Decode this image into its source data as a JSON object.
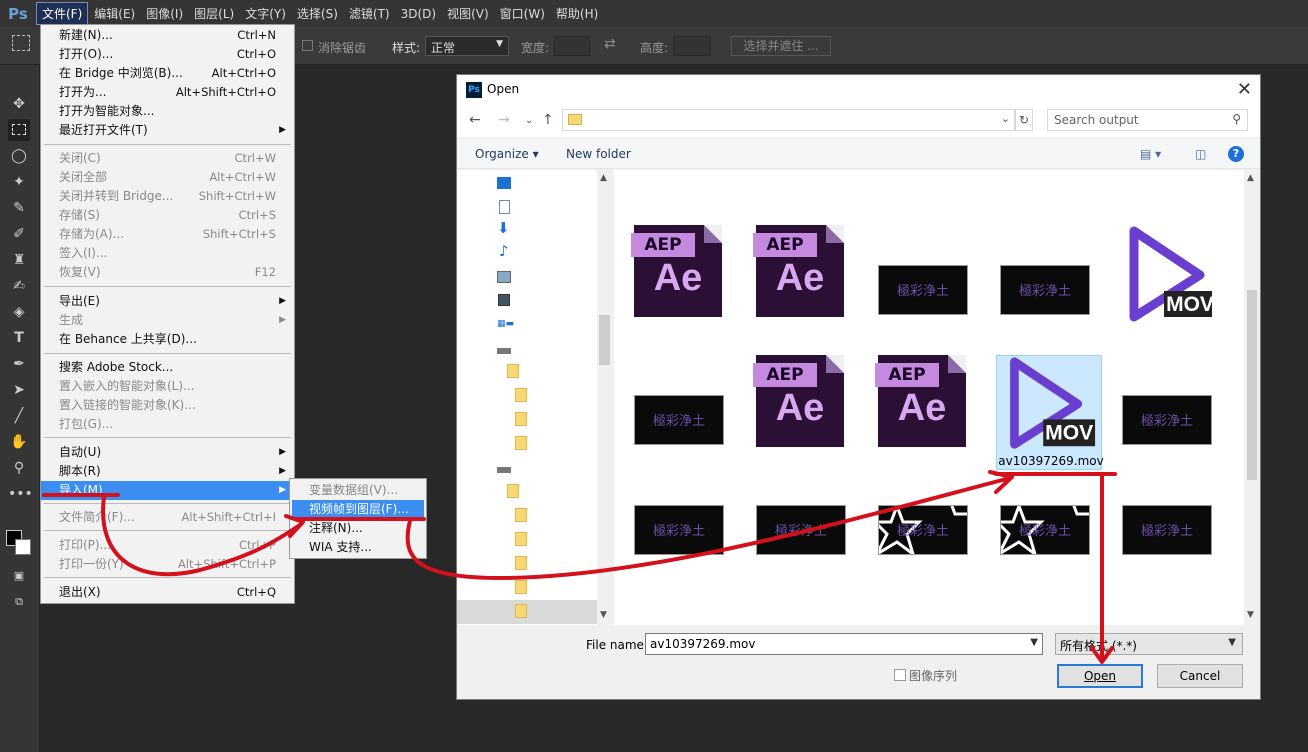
{
  "menubar": {
    "logo": "Ps",
    "items": [
      "文件(F)",
      "编辑(E)",
      "图像(I)",
      "图层(L)",
      "文字(Y)",
      "选择(S)",
      "滤镜(T)",
      "3D(D)",
      "视图(V)",
      "窗口(W)",
      "帮助(H)"
    ]
  },
  "options": {
    "antialias": "消除锯齿",
    "style_label": "样式:",
    "style_value": "正常",
    "width_label": "宽度:",
    "height_label": "高度:",
    "refine_button": "选择并遮住 ..."
  },
  "file_menu": {
    "items": [
      {
        "label": "新建(N)...",
        "shortcut": "Ctrl+N"
      },
      {
        "label": "打开(O)...",
        "shortcut": "Ctrl+O"
      },
      {
        "label": "在 Bridge 中浏览(B)...",
        "shortcut": "Alt+Ctrl+O"
      },
      {
        "label": "打开为...",
        "shortcut": "Alt+Shift+Ctrl+O"
      },
      {
        "label": "打开为智能对象..."
      },
      {
        "label": "最近打开文件(T)",
        "submenu": true
      },
      {
        "label": "关闭(C)",
        "shortcut": "Ctrl+W",
        "disabled": true
      },
      {
        "label": "关闭全部",
        "shortcut": "Alt+Ctrl+W",
        "disabled": true
      },
      {
        "label": "关闭并转到 Bridge...",
        "shortcut": "Shift+Ctrl+W",
        "disabled": true
      },
      {
        "label": "存储(S)",
        "shortcut": "Ctrl+S",
        "disabled": true
      },
      {
        "label": "存储为(A)...",
        "shortcut": "Shift+Ctrl+S",
        "disabled": true
      },
      {
        "label": "签入(I)...",
        "disabled": true
      },
      {
        "label": "恢复(V)",
        "shortcut": "F12",
        "disabled": true
      },
      {
        "label": "导出(E)",
        "submenu": true
      },
      {
        "label": "生成",
        "submenu": true,
        "disabled": true
      },
      {
        "label": "在 Behance 上共享(D)..."
      },
      {
        "label": "搜索 Adobe Stock..."
      },
      {
        "label": "置入嵌入的智能对象(L)...",
        "disabled": true
      },
      {
        "label": "置入链接的智能对象(K)...",
        "disabled": true
      },
      {
        "label": "打包(G)...",
        "disabled": true
      },
      {
        "label": "自动(U)",
        "submenu": true
      },
      {
        "label": "脚本(R)",
        "submenu": true
      },
      {
        "label": "导入(M)",
        "submenu": true,
        "highlighted": true
      },
      {
        "label": "文件简介(F)...",
        "shortcut": "Alt+Shift+Ctrl+I",
        "disabled": true
      },
      {
        "label": "打印(P)...",
        "shortcut": "Ctrl+P",
        "disabled": true
      },
      {
        "label": "打印一份(Y)",
        "shortcut": "Alt+Shift+Ctrl+P",
        "disabled": true
      },
      {
        "label": "退出(X)",
        "shortcut": "Ctrl+Q"
      }
    ]
  },
  "import_submenu": {
    "items": [
      {
        "label": "变量数据组(V)...",
        "disabled": true
      },
      {
        "label": "视频帧到图层(F)...",
        "highlighted": true
      },
      {
        "label": "注释(N)..."
      },
      {
        "label": "WIA 支持..."
      }
    ]
  },
  "dialog": {
    "title": "Open",
    "search_placeholder": "Search output",
    "organize": "Organize ▾",
    "new_folder": "New folder",
    "files": [
      {
        "type": "ae",
        "tag": "AEP",
        "letters": "Ae"
      },
      {
        "type": "ae",
        "tag": "AEP",
        "letters": "Ae"
      },
      {
        "type": "thumb",
        "title": "極彩浄土"
      },
      {
        "type": "thumb",
        "title": "極彩浄土"
      },
      {
        "type": "mov",
        "badge": "MOV"
      },
      {
        "type": "thumb",
        "title": "極彩浄土"
      },
      {
        "type": "ae",
        "tag": "AEP",
        "letters": "Ae"
      },
      {
        "type": "ae",
        "tag": "AEP",
        "letters": "Ae"
      },
      {
        "type": "mov",
        "badge": "MOV",
        "name": "av10397269.mov",
        "selected": true
      },
      {
        "type": "thumb",
        "title": "極彩浄土"
      },
      {
        "type": "thumb",
        "title": "極彩浄土"
      },
      {
        "type": "thumb",
        "title": "極彩浄土"
      },
      {
        "type": "thumb-star",
        "title": "極彩浄土"
      },
      {
        "type": "thumb-star",
        "title": "極彩浄土"
      },
      {
        "type": "thumb",
        "title": "極彩浄土"
      }
    ],
    "filename_label": "File name:",
    "filename_value": "av10397269.mov",
    "filetype_value": "所有格式 (*.*)",
    "image_sequence_label": "图像序列",
    "open_button": "Open",
    "cancel_button": "Cancel"
  },
  "colors": {
    "annotation_red": "#d4101c",
    "menu_highlight": "#3b8df0",
    "mov_purple": "#6a3fd0"
  }
}
